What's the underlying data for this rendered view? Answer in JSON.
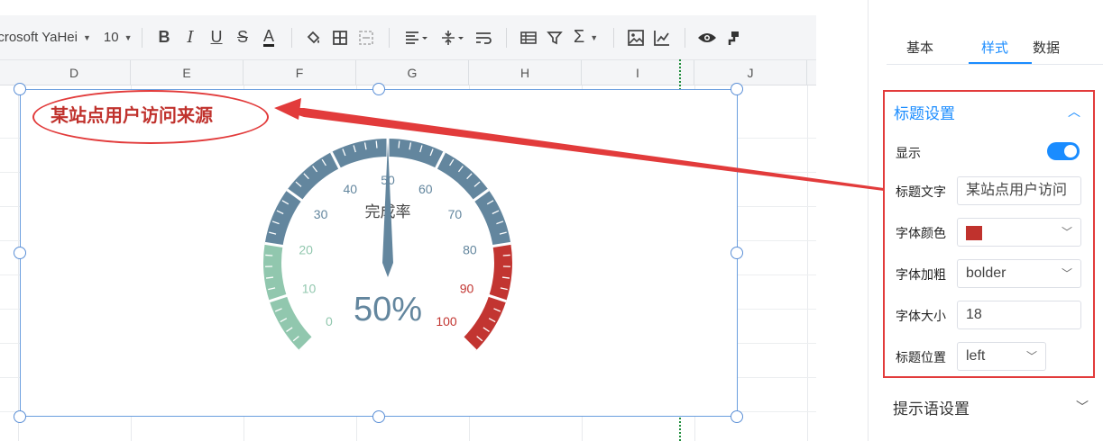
{
  "toolbar": {
    "font_name": "icrosoft YaHei",
    "font_size": "10",
    "bold": "B",
    "italic": "I",
    "underline": "U",
    "strike": "S",
    "font_color": "A",
    "sigma": "Σ"
  },
  "columns": [
    "D",
    "E",
    "F",
    "G",
    "H",
    "I",
    "J"
  ],
  "chart": {
    "title": "某站点用户访问来源",
    "title_color": "#c0322d",
    "series_name": "完成率",
    "value_label": "50%"
  },
  "chart_data": {
    "type": "gauge",
    "title": "某站点用户访问来源",
    "series_name": "完成率",
    "value": 50,
    "min": 0,
    "max": 100,
    "tick_labels": [
      "0",
      "10",
      "20",
      "30",
      "40",
      "50",
      "60",
      "70",
      "80",
      "90",
      "100"
    ],
    "bands": [
      {
        "from": 0,
        "to": 20,
        "color": "#91c7ae"
      },
      {
        "from": 20,
        "to": 80,
        "color": "#63869e"
      },
      {
        "from": 80,
        "to": 100,
        "color": "#c23531"
      }
    ],
    "detail_text": "50%"
  },
  "panel": {
    "tabs": [
      "基本",
      "样式",
      "数据"
    ],
    "active_tab": "样式",
    "section_title": "标题设置",
    "show_label": "显示",
    "show_enabled": true,
    "title_text_label": "标题文字",
    "title_text_value": "某站点用户访问",
    "font_color_label": "字体颜色",
    "font_color_value": "#c0322d",
    "font_weight_label": "字体加粗",
    "font_weight_value": "bolder",
    "font_size_label": "字体大小",
    "font_size_value": "18",
    "title_position_label": "标题位置",
    "title_position_value": "left",
    "tooltip_section_title": "提示语设置"
  }
}
